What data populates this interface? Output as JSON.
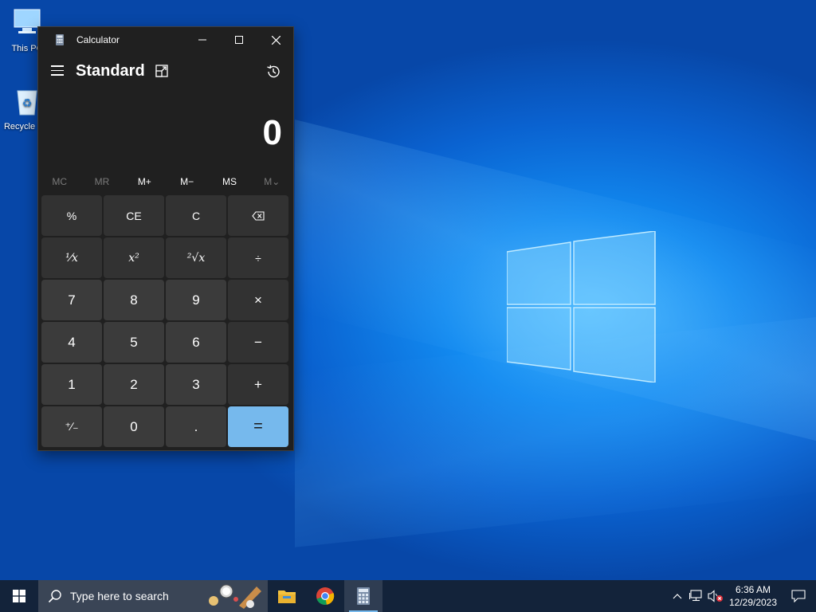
{
  "desktop": {
    "icons": [
      {
        "label": "This PC",
        "icon": "this-pc-icon"
      },
      {
        "label": "Recycle Bin",
        "icon": "recycle-bin-icon"
      }
    ]
  },
  "calculator": {
    "window_title": "Calculator",
    "mode": "Standard",
    "display_value": "0",
    "memory": [
      {
        "label": "MC",
        "enabled": false
      },
      {
        "label": "MR",
        "enabled": false
      },
      {
        "label": "M+",
        "enabled": true
      },
      {
        "label": "M−",
        "enabled": true
      },
      {
        "label": "MS",
        "enabled": true
      },
      {
        "label": "M⌄",
        "enabled": false
      }
    ],
    "keys": {
      "percent": "%",
      "ce": "CE",
      "c": "C",
      "backspace": "⌫",
      "reciprocal": "⅟x",
      "square": "x²",
      "sqrt": "²√x",
      "divide": "÷",
      "seven": "7",
      "eight": "8",
      "nine": "9",
      "multiply": "×",
      "four": "4",
      "five": "5",
      "six": "6",
      "minus": "−",
      "one": "1",
      "two": "2",
      "three": "3",
      "plus": "+",
      "negate": "⁺∕₋",
      "zero": "0",
      "decimal": ".",
      "equals": "="
    }
  },
  "taskbar": {
    "search_placeholder": "Type here to search",
    "apps": [
      "file-explorer-icon",
      "chrome-icon",
      "calculator-icon"
    ],
    "clock": {
      "time": "6:36 AM",
      "date": "12/29/2023"
    }
  },
  "colors": {
    "accent": "#76b9ed",
    "window_bg": "#202020",
    "taskbar_bg": "#13233a"
  }
}
